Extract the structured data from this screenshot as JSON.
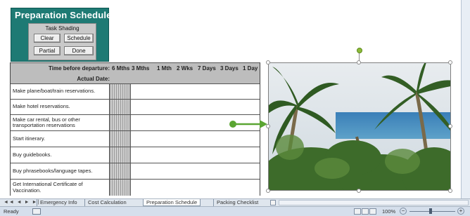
{
  "title_panel": {
    "title": "Preparation Schedule",
    "task_shading_label": "Task Shading",
    "buttons": {
      "clear": "Clear",
      "schedule": "Schedule",
      "partial": "Partial",
      "done": "Done"
    }
  },
  "table": {
    "time_before_label": "Time before departure:",
    "intervals": [
      "6 Mths",
      "3 Mths",
      "1 Mth",
      "2 Wks",
      "7 Days",
      "3 Days",
      "1 Day"
    ],
    "actual_date_label": "Actual Date:",
    "tasks": [
      "Make plane/boat/train reservations.",
      "Make hotel reservations.",
      "Make car rental, bus or other transportation reservations",
      "Start itinerary.",
      "Buy guidebooks.",
      "Buy phrasebooks/language tapes.",
      "Get International Certificate of Vaccination."
    ]
  },
  "picture": {
    "subject": "palm trees and ocean photo",
    "arrow_color": "#5aa532"
  },
  "sheet_tabs": {
    "nav_glyphs": "◄◄ ◄ ► ►|",
    "tabs": [
      "Emergency Info",
      "Cost Calculation",
      "Preparation Schedule",
      "Packing Checklist"
    ],
    "active": "Preparation Schedule"
  },
  "status_bar": {
    "ready": "Ready",
    "zoom": "100%",
    "zoom_minus": "−",
    "zoom_plus": "+"
  },
  "colors": {
    "panel": "#1e7a74",
    "header_gray": "#bdbdbd"
  }
}
